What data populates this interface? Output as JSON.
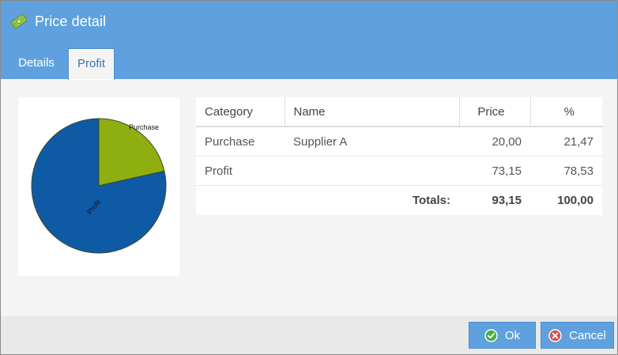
{
  "dialog": {
    "title": "Price detail",
    "icon": "money-icon"
  },
  "tabs": [
    {
      "label": "Details",
      "active": false
    },
    {
      "label": "Profit",
      "active": true
    }
  ],
  "table": {
    "columns": [
      "Category",
      "Name",
      "Price",
      "%"
    ],
    "rows": [
      {
        "category": "Purchase",
        "name": "Supplier A",
        "price": "20,00",
        "percent": "21,47"
      },
      {
        "category": "Profit",
        "name": "",
        "price": "73,15",
        "percent": "78,53"
      }
    ],
    "totals": {
      "label": "Totals:",
      "price": "93,15",
      "percent": "100,00"
    }
  },
  "chart_data": {
    "type": "pie",
    "categories": [
      "Purchase",
      "Profit"
    ],
    "values": [
      21.47,
      78.53
    ],
    "colors": [
      "#8faf10",
      "#0f5aa5"
    ],
    "title": "",
    "legend": "none"
  },
  "buttons": {
    "ok_label": "Ok",
    "cancel_label": "Cancel"
  },
  "colors": {
    "header": "#5fa1de",
    "accent": "#3b73aa",
    "ok_icon": "#4cae4c",
    "cancel_icon": "#d9534f"
  }
}
